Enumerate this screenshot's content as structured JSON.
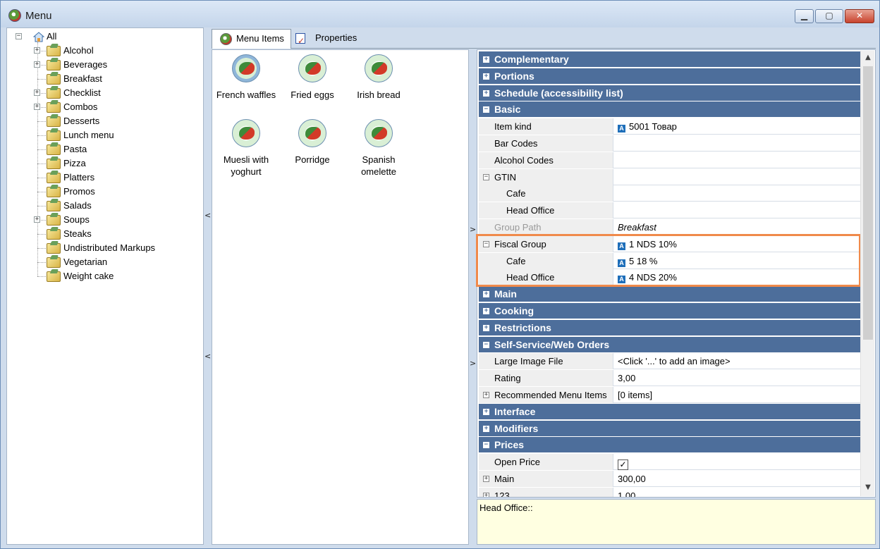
{
  "window": {
    "title": "Menu",
    "controls": [
      "minimize",
      "maximize",
      "close"
    ]
  },
  "tree": {
    "root": "All",
    "items": [
      {
        "label": "Alcohol",
        "expandable": true
      },
      {
        "label": "Beverages",
        "expandable": true
      },
      {
        "label": "Breakfast",
        "expandable": false
      },
      {
        "label": "Checklist",
        "expandable": true
      },
      {
        "label": "Combos",
        "expandable": true
      },
      {
        "label": "Desserts",
        "expandable": false
      },
      {
        "label": "Lunch menu",
        "expandable": false
      },
      {
        "label": "Pasta",
        "expandable": false
      },
      {
        "label": "Pizza",
        "expandable": false
      },
      {
        "label": "Platters",
        "expandable": false
      },
      {
        "label": "Promos",
        "expandable": false
      },
      {
        "label": "Salads",
        "expandable": false
      },
      {
        "label": "Soups",
        "expandable": true
      },
      {
        "label": "Steaks",
        "expandable": false
      },
      {
        "label": "Undistributed Markups",
        "expandable": false
      },
      {
        "label": "Vegetarian",
        "expandable": false
      },
      {
        "label": "Weight cake",
        "expandable": false
      }
    ]
  },
  "tabs": [
    {
      "label": "Menu Items",
      "active": true,
      "icon": "menu-icon"
    },
    {
      "label": "Properties",
      "active": false,
      "icon": "properties-icon"
    }
  ],
  "menu_items": [
    {
      "line1": "French waffles",
      "line2": "",
      "selected": true
    },
    {
      "line1": "Fried eggs",
      "line2": ""
    },
    {
      "line1": "Irish bread",
      "line2": ""
    },
    {
      "line1": "Muesli with",
      "line2": "yoghurt"
    },
    {
      "line1": "Porridge",
      "line2": ""
    },
    {
      "line1": "Spanish",
      "line2": "omelette"
    }
  ],
  "properties": {
    "rows": [
      {
        "type": "cat",
        "toggle": "+",
        "label": "Complementary"
      },
      {
        "type": "cat",
        "toggle": "+",
        "label": "Portions"
      },
      {
        "type": "cat",
        "toggle": "+",
        "label": "Schedule (accessibility list)"
      },
      {
        "type": "cat",
        "toggle": "−",
        "label": "Basic"
      },
      {
        "type": "prop",
        "name": "Item kind",
        "value": "5001 Товар",
        "icon": true
      },
      {
        "type": "prop",
        "name": "Bar Codes",
        "value": ""
      },
      {
        "type": "prop",
        "name": "Alcohol Codes",
        "value": ""
      },
      {
        "type": "prop",
        "name": "GTIN",
        "value": "",
        "toggle": "−"
      },
      {
        "type": "prop",
        "name": "Cafe",
        "value": "",
        "level": 2
      },
      {
        "type": "prop",
        "name": "Head Office",
        "value": "",
        "level": 2
      },
      {
        "type": "prop",
        "name": "Group Path",
        "value": "Breakfast",
        "dim": true,
        "italic": true
      },
      {
        "type": "prop",
        "name": "Fiscal Group",
        "value": "1 NDS 10%",
        "icon": true,
        "toggle": "−"
      },
      {
        "type": "prop",
        "name": "Cafe",
        "value": "5 18 %",
        "icon": true,
        "level": 2
      },
      {
        "type": "prop",
        "name": "Head Office",
        "value": "4 NDS 20%",
        "icon": true,
        "level": 2
      },
      {
        "type": "cat",
        "toggle": "+",
        "label": "Main"
      },
      {
        "type": "cat",
        "toggle": "+",
        "label": "Cooking"
      },
      {
        "type": "cat",
        "toggle": "+",
        "label": "Restrictions"
      },
      {
        "type": "cat",
        "toggle": "−",
        "label": "Self-Service/Web Orders"
      },
      {
        "type": "prop",
        "name": "Large Image File",
        "value": "<Click '...' to add an image>"
      },
      {
        "type": "prop",
        "name": "Rating",
        "value": "3,00"
      },
      {
        "type": "prop",
        "name": "Recommended Menu Items",
        "value": "[0 items]",
        "toggle": "+"
      },
      {
        "type": "cat",
        "toggle": "+",
        "label": "Interface"
      },
      {
        "type": "cat",
        "toggle": "+",
        "label": "Modifiers"
      },
      {
        "type": "cat",
        "toggle": "−",
        "label": "Prices"
      },
      {
        "type": "prop",
        "name": "Open Price",
        "value": "",
        "checkbox": true
      },
      {
        "type": "prop",
        "name": "Main",
        "value": "300,00",
        "toggle": "+"
      },
      {
        "type": "prop",
        "name": "123",
        "value": "1,00",
        "toggle": "+"
      }
    ]
  },
  "description": "Head Office::",
  "colors": {
    "category_bar": "#4d6e9b",
    "highlight": "#f08a4b",
    "description_bg": "#ffffe1"
  }
}
